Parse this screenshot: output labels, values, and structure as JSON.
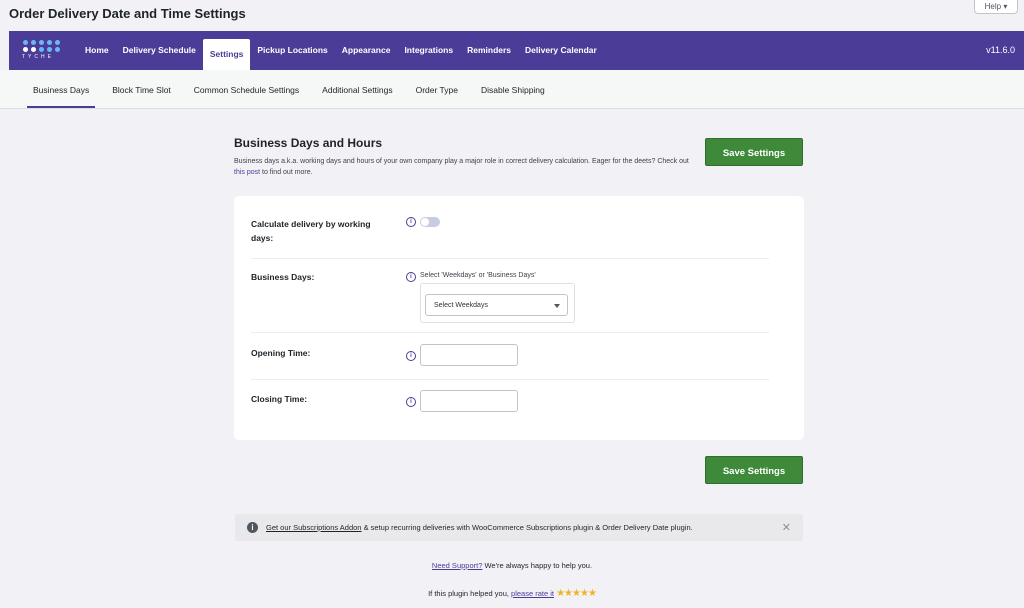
{
  "page": {
    "title": "Order Delivery Date and Time Settings"
  },
  "help": {
    "label": "Help ▾"
  },
  "topnav": {
    "logo_text": "TYCHE",
    "items": [
      {
        "label": "Home"
      },
      {
        "label": "Delivery Schedule"
      },
      {
        "label": "Settings"
      },
      {
        "label": "Pickup Locations"
      },
      {
        "label": "Appearance"
      },
      {
        "label": "Integrations"
      },
      {
        "label": "Reminders"
      },
      {
        "label": "Delivery Calendar"
      }
    ],
    "active_index": 2,
    "version": "v11.6.0",
    "color": "#4b3d97"
  },
  "subnav": {
    "items": [
      {
        "label": "Business Days"
      },
      {
        "label": "Block Time Slot"
      },
      {
        "label": "Common Schedule Settings"
      },
      {
        "label": "Additional Settings"
      },
      {
        "label": "Order Type"
      },
      {
        "label": "Disable Shipping"
      }
    ],
    "active_index": 0
  },
  "section": {
    "title": "Business Days and Hours",
    "desc_before": "Business days a.k.a. working days and hours of your own company play a major role in correct delivery calculation. Eager for the deets? Check out ",
    "desc_link": "this post",
    "desc_after": " to find out more."
  },
  "save_label": "Save Settings",
  "form": {
    "calc_label": "Calculate delivery by working days:",
    "calc_enabled": false,
    "business_days_label": "Business Days:",
    "business_days_hint": "Select 'Weekdays' or 'Business Days'",
    "business_days_selected": "Select Weekdays",
    "opening_label": "Opening Time:",
    "opening_value": "",
    "closing_label": "Closing Time:",
    "closing_value": ""
  },
  "icons": {
    "info": "info-icon",
    "notice": "info-circle-icon",
    "close": "close-icon"
  },
  "notice": {
    "link": "Get our Subscriptions Addon",
    "text": " & setup recurring deliveries with WooCommerce Subscriptions plugin & Order Delivery Date plugin.",
    "close": "✕"
  },
  "support": {
    "link": "Need Support?",
    "text": " We're always happy to help you."
  },
  "rate": {
    "text": "If this plugin helped you, ",
    "link": "please rate it",
    "stars": "★★★★★"
  },
  "colors": {
    "accent": "#4b3d97",
    "save_button": "#3e8a3a",
    "star": "#f0b323"
  }
}
